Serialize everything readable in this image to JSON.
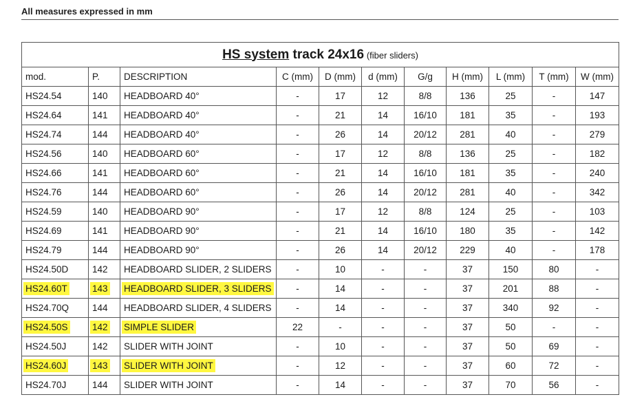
{
  "header": {
    "note": "All measures expressed in mm"
  },
  "table": {
    "title_underlined": "HS system",
    "title_rest": " track 24x16",
    "title_sub": "(fiber sliders)",
    "columns": [
      "mod.",
      "P.",
      "DESCRIPTION",
      "C (mm)",
      "D (mm)",
      "d (mm)",
      "G/g",
      "H (mm)",
      "L (mm)",
      "T (mm)",
      "W (mm)"
    ],
    "rows": [
      {
        "cells": [
          "HS24.54",
          "140",
          "HEADBOARD 40°",
          "-",
          "17",
          "12",
          "8/8",
          "136",
          "25",
          "-",
          "147"
        ],
        "highlight": false
      },
      {
        "cells": [
          "HS24.64",
          "141",
          "HEADBOARD 40°",
          "-",
          "21",
          "14",
          "16/10",
          "181",
          "35",
          "-",
          "193"
        ],
        "highlight": false
      },
      {
        "cells": [
          "HS24.74",
          "144",
          "HEADBOARD 40°",
          "-",
          "26",
          "14",
          "20/12",
          "281",
          "40",
          "-",
          "279"
        ],
        "highlight": false
      },
      {
        "cells": [
          "HS24.56",
          "140",
          "HEADBOARD 60°",
          "-",
          "17",
          "12",
          "8/8",
          "136",
          "25",
          "-",
          "182"
        ],
        "highlight": false
      },
      {
        "cells": [
          "HS24.66",
          "141",
          "HEADBOARD 60°",
          "-",
          "21",
          "14",
          "16/10",
          "181",
          "35",
          "-",
          "240"
        ],
        "highlight": false
      },
      {
        "cells": [
          "HS24.76",
          "144",
          "HEADBOARD 60°",
          "-",
          "26",
          "14",
          "20/12",
          "281",
          "40",
          "-",
          "342"
        ],
        "highlight": false
      },
      {
        "cells": [
          "HS24.59",
          "140",
          "HEADBOARD 90°",
          "-",
          "17",
          "12",
          "8/8",
          "124",
          "25",
          "-",
          "103"
        ],
        "highlight": false
      },
      {
        "cells": [
          "HS24.69",
          "141",
          "HEADBOARD 90°",
          "-",
          "21",
          "14",
          "16/10",
          "180",
          "35",
          "-",
          "142"
        ],
        "highlight": false
      },
      {
        "cells": [
          "HS24.79",
          "144",
          "HEADBOARD 90°",
          "-",
          "26",
          "14",
          "20/12",
          "229",
          "40",
          "-",
          "178"
        ],
        "highlight": false
      },
      {
        "cells": [
          "HS24.50D",
          "142",
          "HEADBOARD SLIDER, 2 SLIDERS",
          "-",
          "10",
          "-",
          "-",
          "37",
          "150",
          "80",
          "-"
        ],
        "highlight": false
      },
      {
        "cells": [
          "HS24.60T",
          "143",
          "HEADBOARD SLIDER, 3 SLIDERS",
          "-",
          "14",
          "-",
          "-",
          "37",
          "201",
          "88",
          "-"
        ],
        "highlight": true
      },
      {
        "cells": [
          "HS24.70Q",
          "144",
          "HEADBOARD SLIDER, 4 SLIDERS",
          "-",
          "14",
          "-",
          "-",
          "37",
          "340",
          "92",
          "-"
        ],
        "highlight": false
      },
      {
        "cells": [
          "HS24.50S",
          "142",
          "SIMPLE SLIDER",
          "22",
          "-",
          "-",
          "-",
          "37",
          "50",
          "-",
          "-"
        ],
        "highlight": true
      },
      {
        "cells": [
          "HS24.50J",
          "142",
          "SLIDER WITH JOINT",
          "-",
          "10",
          "-",
          "-",
          "37",
          "50",
          "69",
          "-"
        ],
        "highlight": false
      },
      {
        "cells": [
          "HS24.60J",
          "143",
          "SLIDER WITH JOINT",
          "-",
          "12",
          "-",
          "-",
          "37",
          "60",
          "72",
          "-"
        ],
        "highlight": true
      },
      {
        "cells": [
          "HS24.70J",
          "144",
          "SLIDER WITH JOINT",
          "-",
          "14",
          "-",
          "-",
          "37",
          "70",
          "56",
          "-"
        ],
        "highlight": false
      }
    ]
  },
  "colors": {
    "highlight": "#fff740",
    "border": "#555555",
    "text": "#1a1a1a"
  }
}
